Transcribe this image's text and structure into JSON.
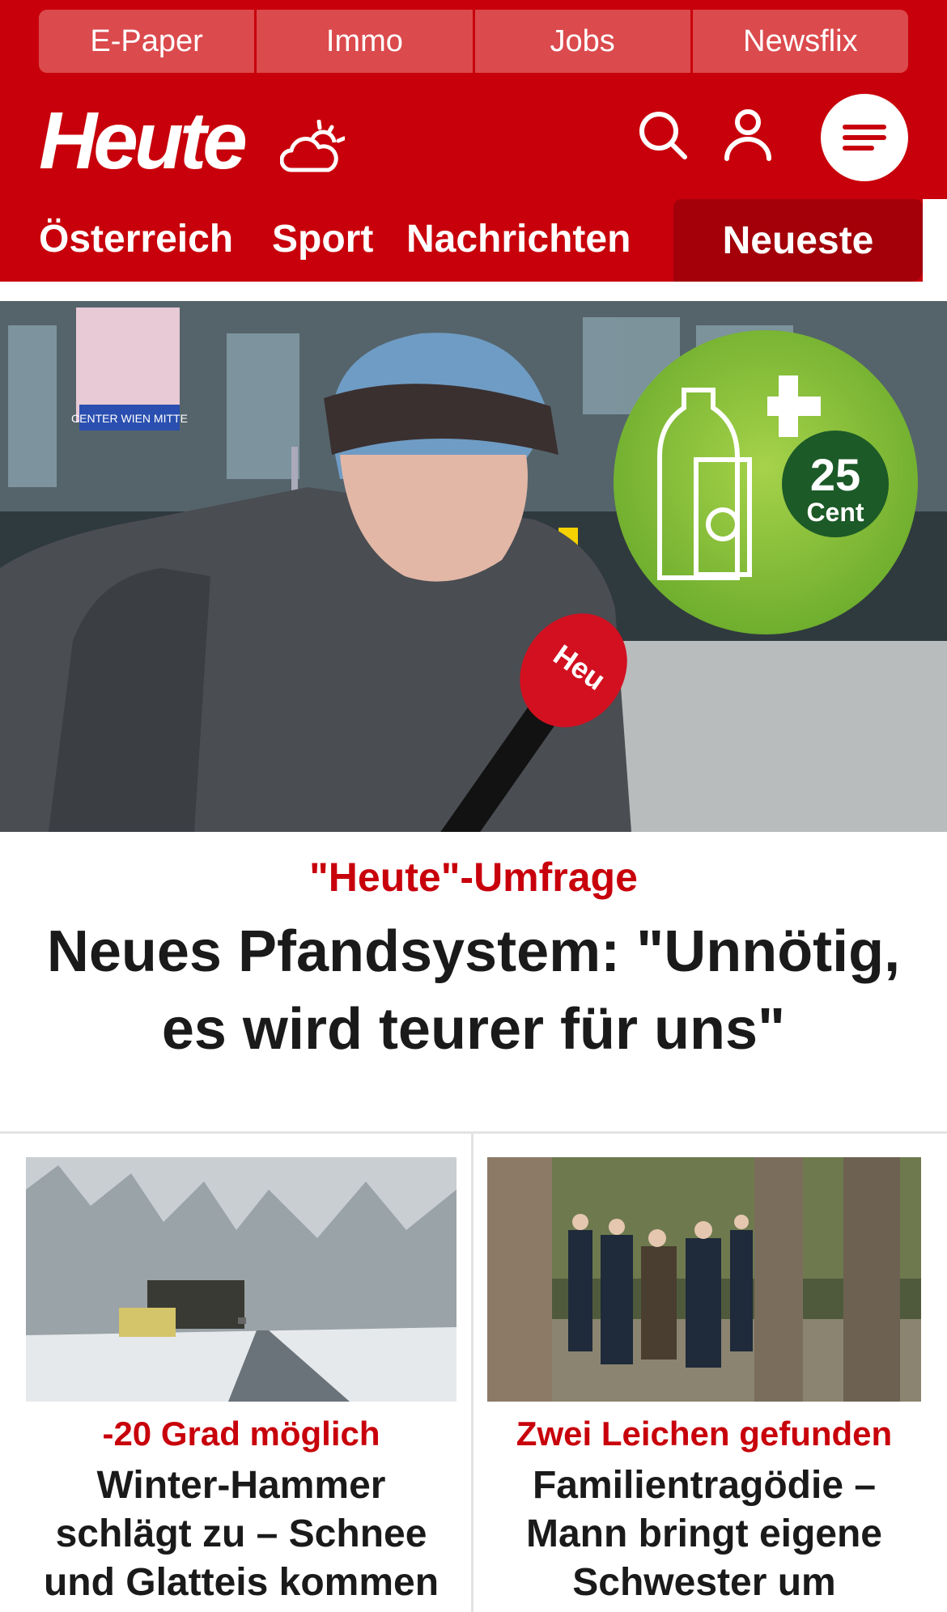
{
  "topnav": {
    "items": [
      "E-Paper",
      "Immo",
      "Jobs",
      "Newsflix"
    ]
  },
  "header": {
    "logo": "Heute",
    "weather_icon": "cloud-sun-icon",
    "search_icon": "search-icon",
    "user_icon": "user-icon",
    "menu_icon": "hamburger-menu-icon"
  },
  "sections": {
    "items": [
      "Österreich",
      "Sport",
      "Nachrichten"
    ],
    "active": "Neueste"
  },
  "hero": {
    "kicker": "\"Heute\"-Umfrage",
    "title": "Neues Pfandsystem: \"Unnötig, es wird teurer für uns\"",
    "badge": {
      "amount": "25",
      "unit": "Cent"
    },
    "mic_label": "Heu",
    "sign_label": "CENTER WIEN MITTE"
  },
  "cards": [
    {
      "kicker": "-20 Grad möglich",
      "title": "Winter-Hammer schlägt zu – Schnee und Glatteis kommen"
    },
    {
      "kicker": "Zwei Leichen gefunden",
      "title": "Familientragödie – Mann bringt eigene Schwester um"
    }
  ],
  "colors": {
    "brand_red": "#c8000b",
    "nav_item": "#db4a4d",
    "active_tab": "#a3000a",
    "pfand_green": "#8bc34a"
  }
}
